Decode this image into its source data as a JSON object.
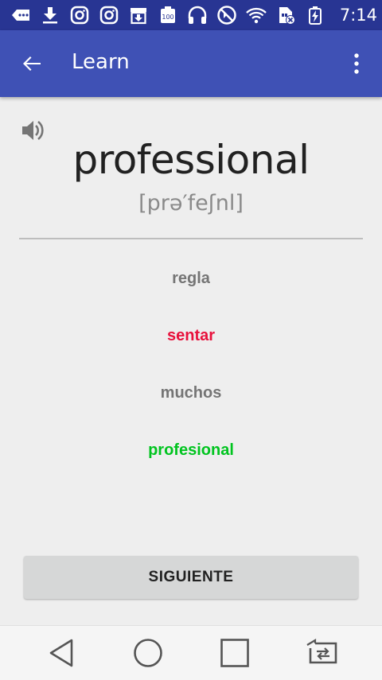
{
  "status_bar": {
    "time": "7:14",
    "icons": [
      "more-messages-icon",
      "download-icon",
      "instagram-icon",
      "instagram-icon",
      "archive-download-icon",
      "battery-100-icon",
      "headphones-icon",
      "do-not-disturb-icon",
      "wifi-icon",
      "sim-error-icon",
      "battery-charging-icon"
    ]
  },
  "app_bar": {
    "title": "Learn"
  },
  "card": {
    "word": "professional",
    "phonetic": "[prə′feʃnl]"
  },
  "options": [
    {
      "text": "regla",
      "color": "#757575"
    },
    {
      "text": "sentar",
      "color": "#e8113c"
    },
    {
      "text": "muchos",
      "color": "#757575"
    },
    {
      "text": "profesional",
      "color": "#00c41f"
    }
  ],
  "next_button": {
    "label": "SIGUIENTE"
  },
  "colors": {
    "status_bar": "#283593",
    "app_bar": "#3f51b5",
    "background": "#eeeeee"
  }
}
